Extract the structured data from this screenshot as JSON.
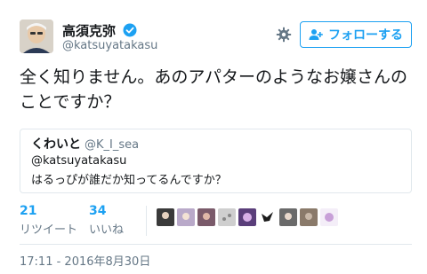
{
  "author": {
    "display_name": "高須克弥",
    "handle": "@katsuyatakasu",
    "verified_icon": "verified-badge-icon"
  },
  "actions": {
    "gear_icon": "gear-icon",
    "follow_label": "フォローする",
    "follow_icon": "add-user-icon"
  },
  "tweet": {
    "text": "全く知りません。あのアパターのようなお嬢さんのことですか？"
  },
  "quoted": {
    "name": "くわいと",
    "handle": "@K_I_sea",
    "line1": "@katsuyatakasu",
    "line2": "はるっぴが誰だか知ってるんですか？"
  },
  "stats": {
    "retweets_count": "21",
    "retweets_label": "リツイート",
    "likes_count": "34",
    "likes_label": "いいね"
  },
  "likers": [
    {
      "color": "#3a3a3a"
    },
    {
      "color": "#b9a9c9"
    },
    {
      "color": "#7a5a6a"
    },
    {
      "color": "#cfcfcf"
    },
    {
      "color": "#5a3e7a"
    },
    {
      "color": "#1a1a1a"
    },
    {
      "color": "#6a6a6a"
    },
    {
      "color": "#8a7a6a"
    },
    {
      "color": "#c8a0d8"
    }
  ],
  "timestamp": "17:11 - 2016年8月30日",
  "colors": {
    "accent": "#1da1f2",
    "muted": "#657786",
    "border": "#e1e8ed"
  }
}
